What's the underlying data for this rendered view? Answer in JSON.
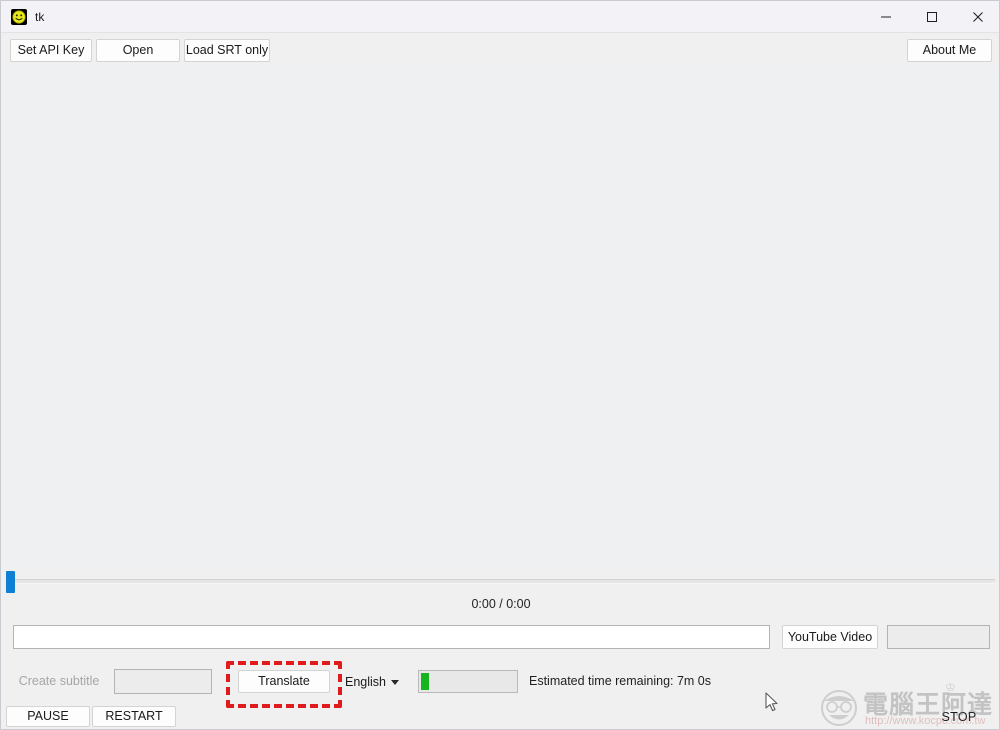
{
  "window": {
    "title": "tk",
    "icon": "smiley-face-icon",
    "controls": {
      "minimize": "minimize-icon",
      "maximize": "maximize-icon",
      "close": "close-icon"
    }
  },
  "toolbar": {
    "set_api_key": "Set API Key",
    "open": "Open",
    "load_srt_only": "Load SRT only",
    "about_me": "About Me"
  },
  "player": {
    "time_display": "0:00 / 0:00",
    "seek_position_percent": 0
  },
  "url_row": {
    "url_value": "",
    "url_placeholder": "",
    "youtube_button": "YouTube Video",
    "side_entry_value": ""
  },
  "actions": {
    "create_subtitle": "Create subtitle",
    "create_subtitle_entry_value": "",
    "translate": "Translate",
    "language_selected": "English",
    "progress_percent": 8,
    "estimated_time": "Estimated time remaining: 7m 0s"
  },
  "transport": {
    "pause": "PAUSE",
    "restart": "RESTART",
    "stop": "STOP"
  },
  "watermark": {
    "brand": "電腦王阿達",
    "url": "http://www.kocpc.com.tw"
  },
  "colors": {
    "accent_blue": "#0f7fd4",
    "progress_green": "#16b41e",
    "highlight_red": "#e01b1b",
    "window_bg": "#f0f0f0",
    "canvas_bg": "#eef0f1"
  }
}
